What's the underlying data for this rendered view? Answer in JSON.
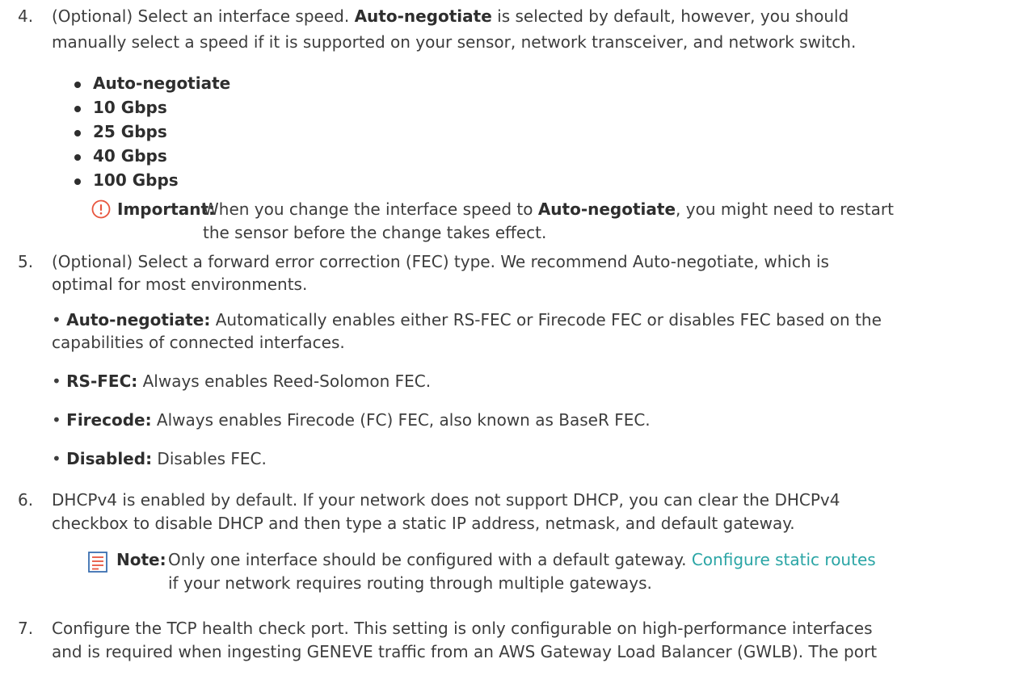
{
  "step4": {
    "number": "4.",
    "intro": "(Optional) Select an interface speed. ",
    "bold": "Auto-negotiate",
    "rest_line1": " is selected by default, however, you should",
    "line2": "manually select a speed if it is supported on your sensor, network transceiver, and network switch.",
    "speeds": [
      "Auto-negotiate",
      "10 Gbps",
      "25 Gbps",
      "40 Gbps",
      "100 Gbps"
    ],
    "important": {
      "label": "Important:",
      "pre": "When you change the interface speed to ",
      "bold": "Auto-negotiate",
      "post": ", you might need to restart",
      "line2": "the sensor before the change takes effect."
    }
  },
  "step5": {
    "number": "5.",
    "line1": "(Optional) Select a forward error correction (FEC) type. We recommend Auto-negotiate, which is",
    "line2": "optimal for most environments.",
    "options": [
      {
        "label": "Auto-negotiate:",
        "desc": " Automatically enables either RS-FEC or Firecode FEC or disables FEC based on the",
        "desc2": "capabilities of connected interfaces."
      },
      {
        "label": "RS-FEC:",
        "desc": " Always enables Reed-Solomon FEC."
      },
      {
        "label": "Firecode:",
        "desc": " Always enables Firecode (FC) FEC, also known as BaseR FEC."
      },
      {
        "label": "Disabled:",
        "desc": " Disables FEC."
      }
    ]
  },
  "step6": {
    "number": "6.",
    "line1": "DHCPv4 is enabled by default. If your network does not support DHCP, you can clear the DHCPv4",
    "line2": "checkbox to disable DHCP and then type a static IP address, netmask, and default gateway.",
    "note": {
      "label": "Note:",
      "pre": "Only one interface should be configured with a default gateway. ",
      "link": "Configure static routes",
      "line2": "if your network requires routing through multiple gateways."
    }
  },
  "step7": {
    "number": "7.",
    "line1": "Configure the TCP health check port. This setting is only configurable on high-performance interfaces",
    "line2": "and is required when ingesting GENEVE traffic from an AWS Gateway Load Balancer (GWLB). The port"
  },
  "colors": {
    "text": "#3d3d3d",
    "link": "#2aa5a5",
    "important_icon": "#e8563f",
    "note_icon": "#e8563f"
  }
}
